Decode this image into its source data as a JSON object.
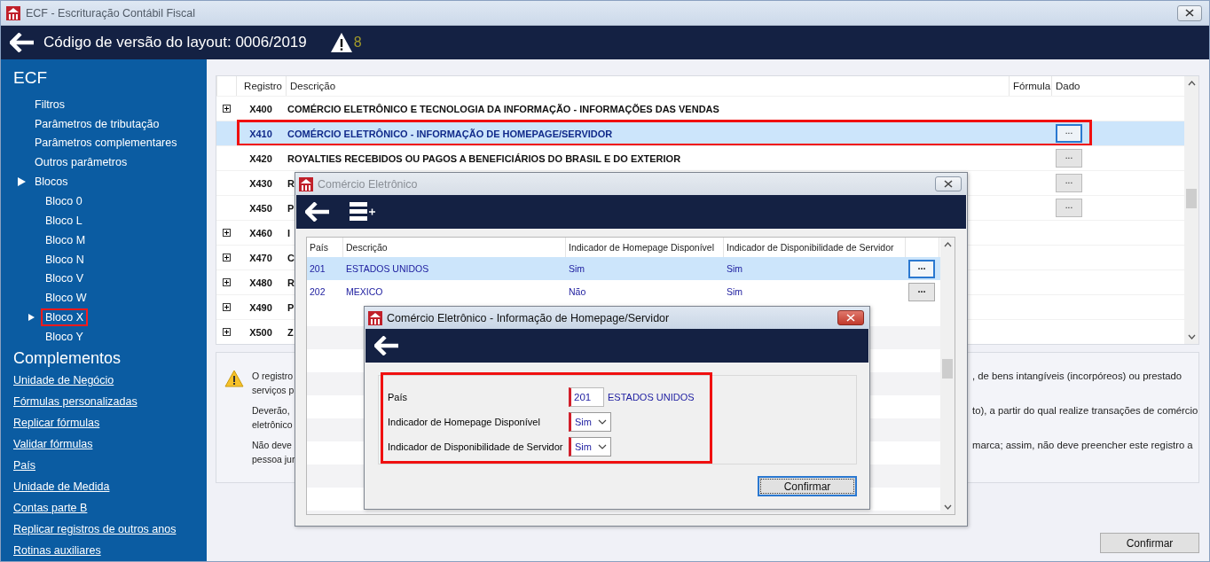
{
  "window": {
    "title": "ECF - Escrituração Contábil Fiscal"
  },
  "header": {
    "title": "Código de versão do layout: 0006/2019",
    "warnings": "8"
  },
  "sidebar": {
    "title": "ECF",
    "items": [
      {
        "label": "Filtros"
      },
      {
        "label": "Parâmetros de tributação"
      },
      {
        "label": "Parâmetros complementares"
      },
      {
        "label": "Outros parâmetros"
      },
      {
        "label": "Blocos",
        "expanded": true,
        "children": [
          {
            "label": "Bloco 0",
            "selected": false,
            "highlighted": false
          },
          {
            "label": "Bloco L",
            "selected": false,
            "highlighted": false
          },
          {
            "label": "Bloco M",
            "selected": false,
            "highlighted": false
          },
          {
            "label": "Bloco N",
            "selected": false,
            "highlighted": false
          },
          {
            "label": "Bloco V",
            "selected": false,
            "highlighted": false
          },
          {
            "label": "Bloco W",
            "selected": false,
            "highlighted": false
          },
          {
            "label": "Bloco X",
            "selected": true,
            "highlighted": true
          },
          {
            "label": "Bloco Y",
            "selected": false,
            "highlighted": false
          }
        ]
      }
    ],
    "complements_title": "Complementos",
    "links": [
      "Unidade de Negócio",
      "Fórmulas personalizadas",
      "Replicar fórmulas",
      "Validar fórmulas",
      "País",
      "Unidade de Medida",
      "Contas parte B",
      "Replicar registros de outros anos",
      "Rotinas auxiliares"
    ]
  },
  "table": {
    "columns": [
      "Registro",
      "Descrição",
      "Fórmula",
      "Dado"
    ],
    "rows": [
      {
        "expandable": true,
        "registro": "X400",
        "descricao": "COMÉRCIO ELETRÔNICO E TECNOLOGIA DA INFORMAÇÃO - INFORMAÇÕES DAS VENDAS",
        "selected": false,
        "highlighted": false
      },
      {
        "expandable": false,
        "registro": "X410",
        "descricao": "COMÉRCIO ELETRÔNICO - INFORMAÇÃO DE HOMEPAGE/SERVIDOR",
        "dado": "...",
        "selected": true,
        "highlighted": true
      },
      {
        "expandable": false,
        "registro": "X420",
        "descricao": "ROYALTIES RECEBIDOS OU PAGOS A BENEFICIÁRIOS DO BRASIL E DO EXTERIOR",
        "dado": "...",
        "selected": false,
        "highlighted": false
      },
      {
        "expandable": false,
        "registro": "X430",
        "descricao": "R",
        "dado": "...",
        "selected": false,
        "highlighted": false
      },
      {
        "expandable": false,
        "registro": "X450",
        "descricao": "P",
        "dado": "...",
        "selected": false,
        "highlighted": false
      },
      {
        "expandable": true,
        "registro": "X460",
        "descricao": "I",
        "selected": false,
        "highlighted": false
      },
      {
        "expandable": true,
        "registro": "X470",
        "descricao": "C",
        "selected": false,
        "highlighted": false
      },
      {
        "expandable": true,
        "registro": "X480",
        "descricao": "R",
        "selected": false,
        "highlighted": false
      },
      {
        "expandable": true,
        "registro": "X490",
        "descricao": "P",
        "selected": false,
        "highlighted": false
      },
      {
        "expandable": true,
        "registro": "X500",
        "descricao": "Z",
        "selected": false,
        "highlighted": false
      }
    ]
  },
  "info": {
    "paragraphs": [
      {
        "lines": [
          {
            "left": "O registro",
            "right": ", de bens intangíveis (incorpóreos) ou prestado"
          },
          {
            "left": "serviços p"
          }
        ]
      },
      {
        "lines": [
          {
            "left": "Deverão,",
            "right": "to), a partir do qual realize transações de comércio"
          },
          {
            "left": "eletrônico"
          }
        ]
      },
      {
        "lines": [
          {
            "left": "Não deve",
            "right": "marca; assim, não deve preencher este registro a"
          },
          {
            "left": "pessoa jur"
          }
        ]
      }
    ]
  },
  "confirm": "Confirmar",
  "dialog": {
    "title": "Comércio Eletrônico",
    "active": false,
    "columns": [
      "País",
      "Descrição",
      "Indicador de Homepage Disponível",
      "Indicador de Disponibilidade de Servidor"
    ],
    "rows": [
      {
        "pais": "201",
        "descricao": "ESTADOS UNIDOS",
        "homepage": "Sim",
        "servidor": "Sim",
        "action": "...",
        "selected": true
      },
      {
        "pais": "202",
        "descricao": "MEXICO",
        "homepage": "Não",
        "servidor": "Sim",
        "action": "...",
        "selected": false
      }
    ]
  },
  "form_dialog": {
    "title": "Comércio Eletrônico - Informação de Homepage/Servidor",
    "active": true,
    "highlighted": true,
    "fields": [
      {
        "kind": "code",
        "label": "País",
        "value": "201",
        "description": "ESTADOS UNIDOS",
        "required": true
      },
      {
        "kind": "select",
        "label": "Indicador de Homepage Disponível",
        "value": "Sim",
        "required": true
      },
      {
        "kind": "select",
        "label": "Indicador de Disponibilidade de Servidor",
        "value": "Sim",
        "required": true
      }
    ],
    "button": "Confirmar"
  }
}
